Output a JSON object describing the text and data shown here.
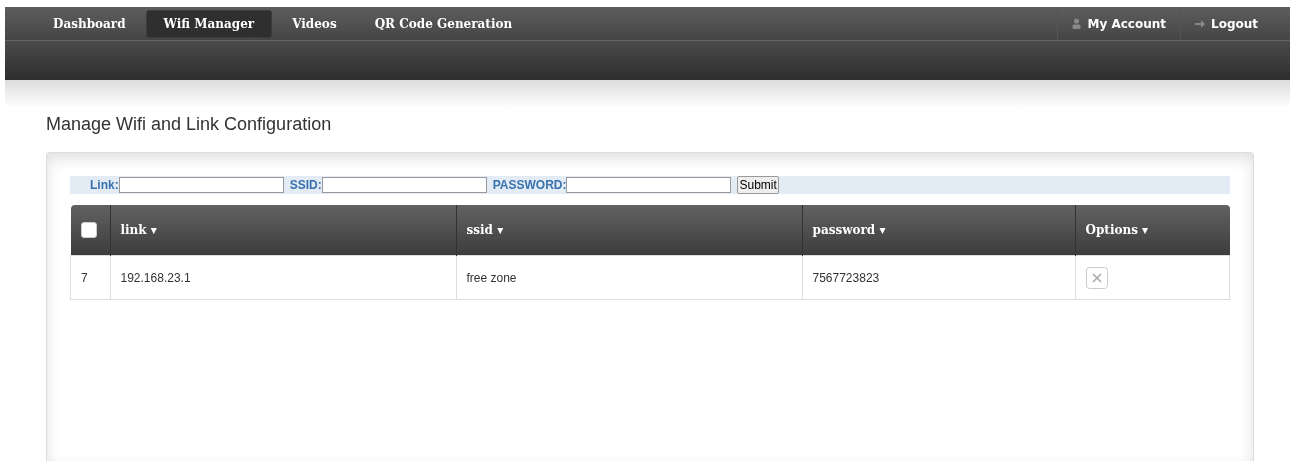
{
  "nav": {
    "items": [
      {
        "label": "Dashboard",
        "selected": false
      },
      {
        "label": "Wifi Manager",
        "selected": true
      },
      {
        "label": "Videos",
        "selected": false
      },
      {
        "label": "QR Code Generation",
        "selected": false
      }
    ],
    "account": "My Account",
    "logout": "Logout"
  },
  "title": "Manage Wifi and Link Configuration",
  "form": {
    "fields": [
      {
        "label": "Link:"
      },
      {
        "label": "SSID:"
      },
      {
        "label": "PASSWORD:"
      }
    ],
    "submit": "Submit"
  },
  "table": {
    "select_all": {
      "checked": false
    },
    "columns": [
      "link ▾",
      "ssid ▾",
      "password ▾",
      "Options ▾"
    ],
    "rows": [
      {
        "id": "7",
        "link": "192.168.23.1",
        "ssid": "free zone",
        "password": "7567723823"
      }
    ]
  }
}
